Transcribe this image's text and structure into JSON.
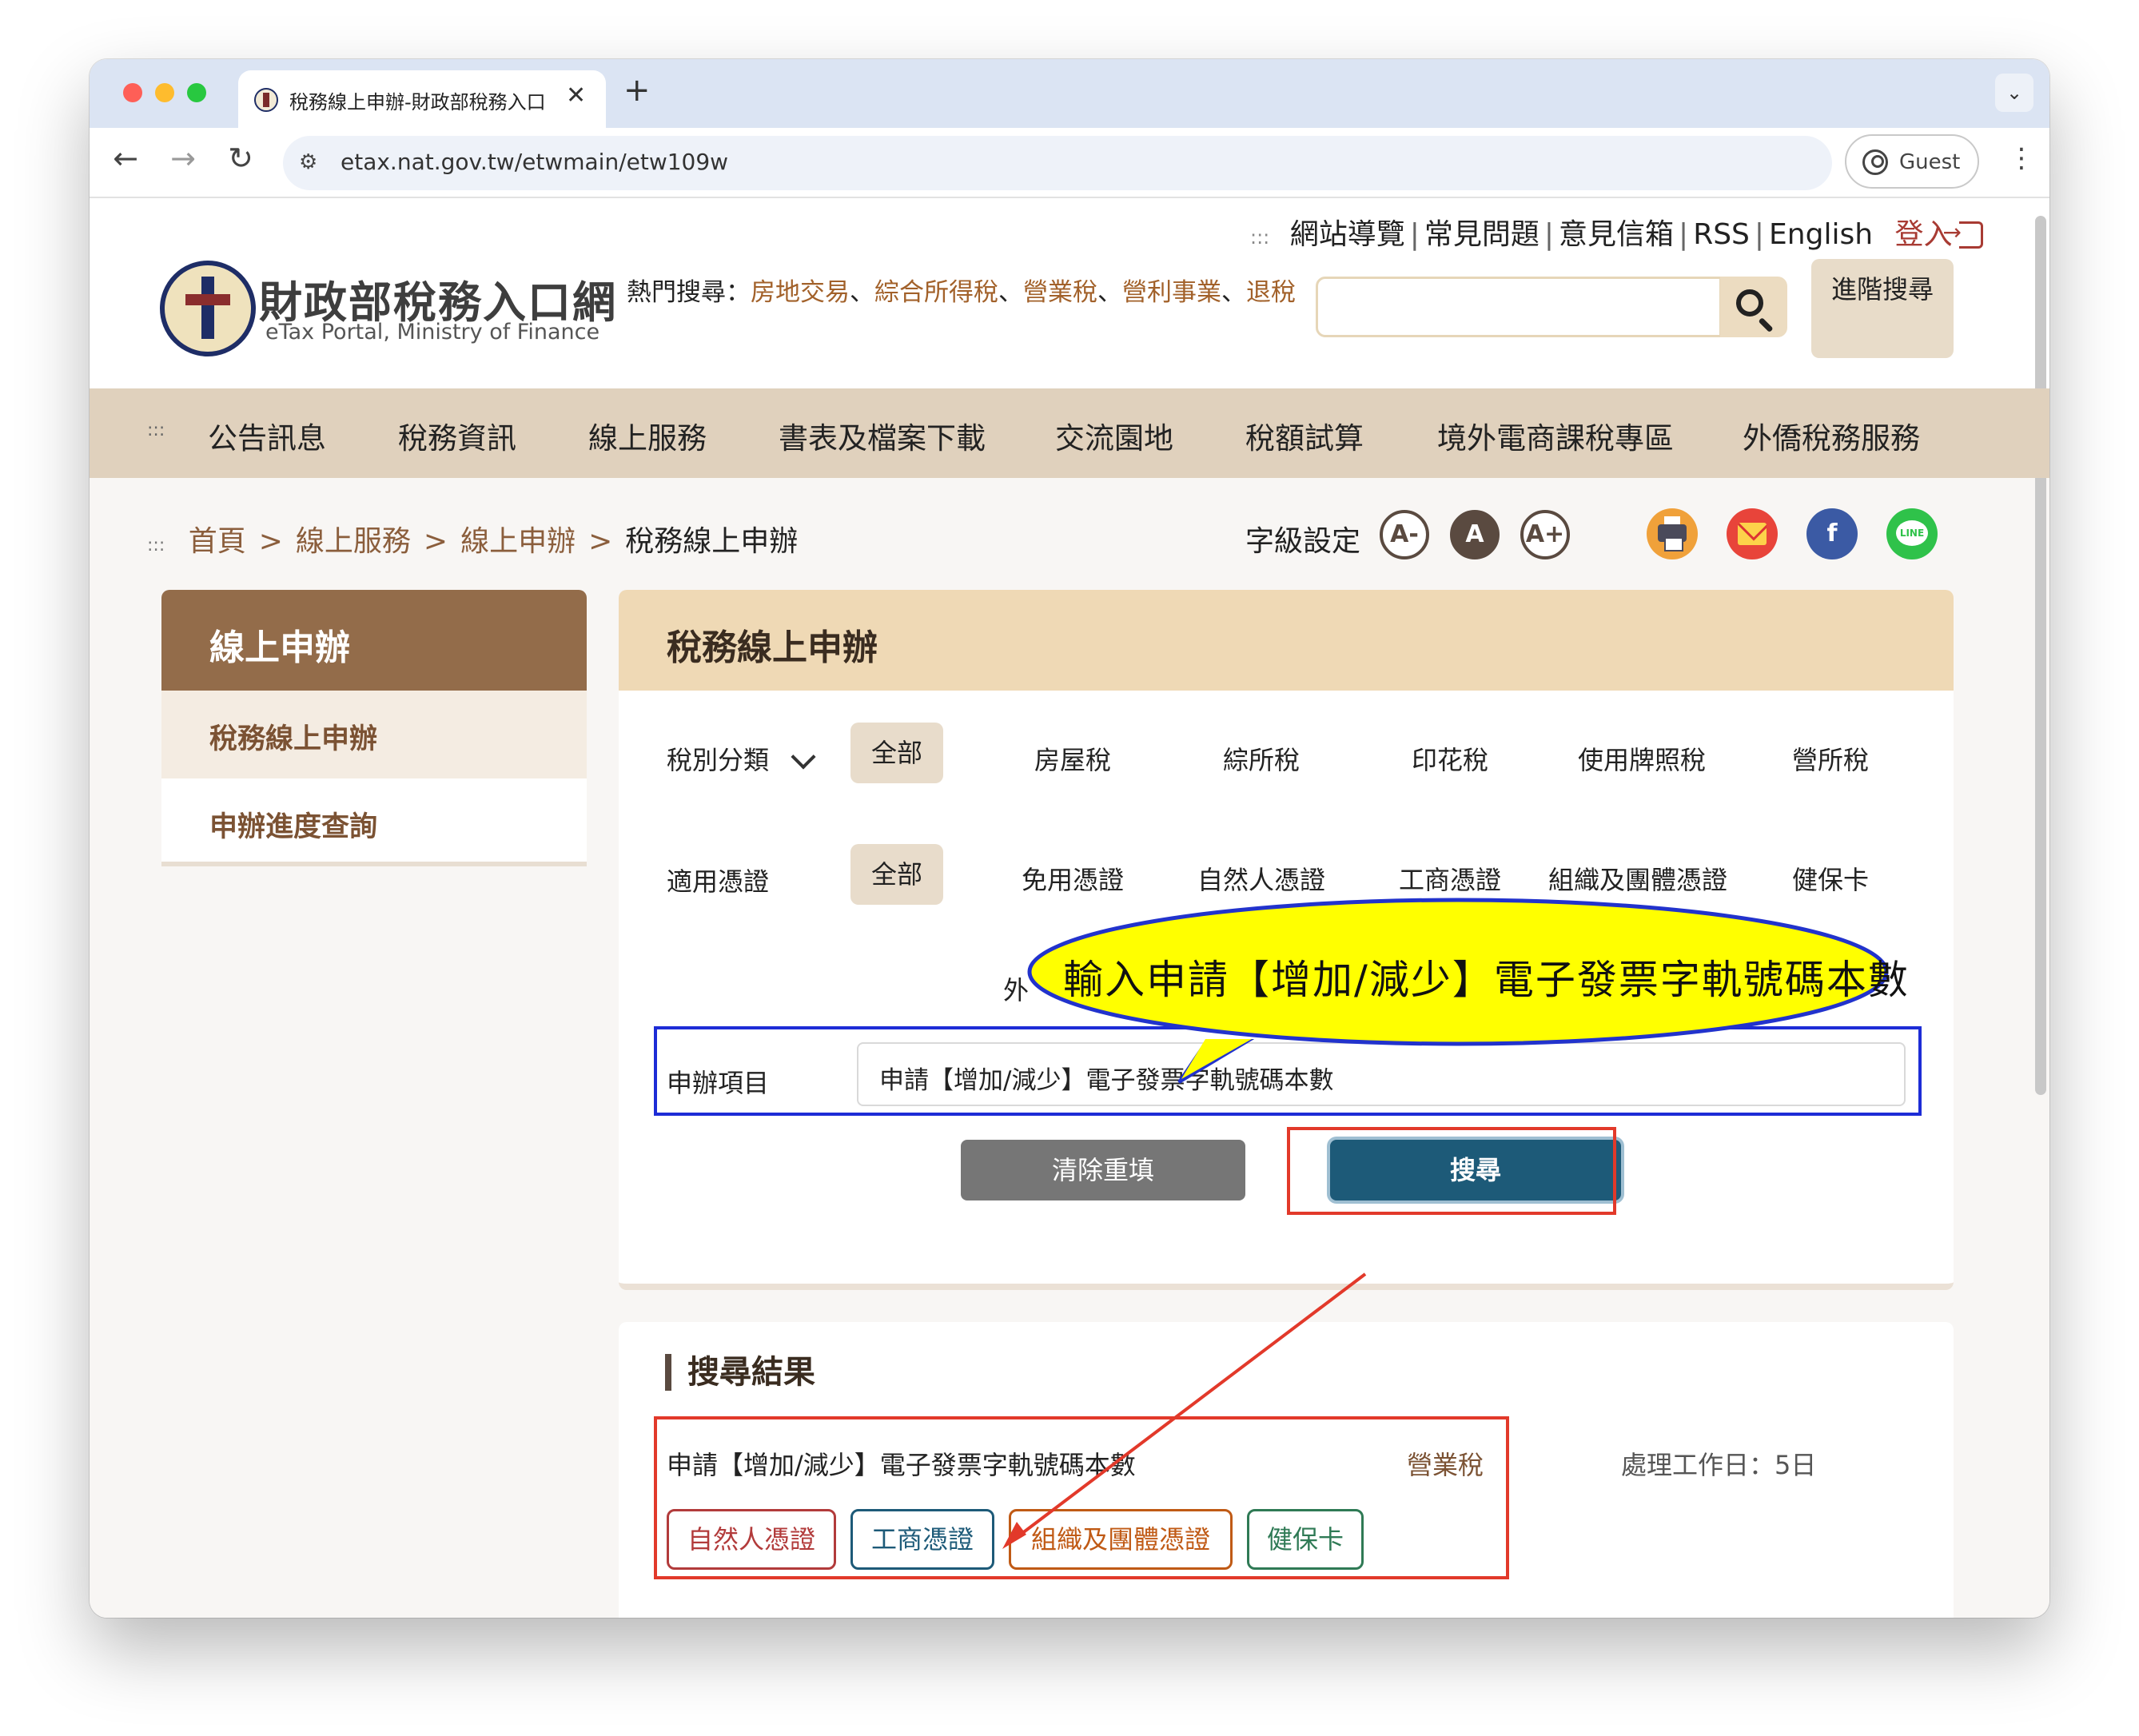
{
  "browser": {
    "tab_title": "稅務線上申辦-財政部稅務入口網",
    "tab_close": "✕",
    "new_tab": "+",
    "tab_menu": "⌄",
    "url": "etax.nat.gov.tw/etwmain/etw109w",
    "profile_label": "Guest",
    "nav_back": "←",
    "nav_forward": "→",
    "nav_reload": "↻",
    "kebab": "⋮",
    "site_info_icon": "⚙"
  },
  "header": {
    "top_links": [
      "網站導覽",
      "常見問題",
      "意見信箱",
      "RSS",
      "English"
    ],
    "login_label": "登入",
    "logo_title": "財政部稅務入口網",
    "logo_subtitle": "eTax Portal, Ministry of Finance",
    "hot_search_label": "熱門搜尋：",
    "hot_search_items": [
      "房地交易",
      "綜合所得稅",
      "營業稅",
      "營利事業",
      "退稅"
    ],
    "search_placeholder": "",
    "advanced_search_label": "進階搜尋"
  },
  "main_nav": [
    "公告訊息",
    "稅務資訊",
    "線上服務",
    "書表及檔案下載",
    "交流園地",
    "稅額試算",
    "境外電商課稅專區",
    "外僑稅務服務"
  ],
  "breadcrumb": [
    "首頁",
    "線上服務",
    "線上申辦",
    "稅務線上申辦"
  ],
  "breadcrumb_sep": ">",
  "font_setting": {
    "label": "字級設定",
    "options": [
      "A-",
      "A",
      "A+"
    ],
    "active": "A"
  },
  "share_icons": [
    "print-icon",
    "mail-icon",
    "facebook-icon",
    "line-icon"
  ],
  "share_labels": {
    "facebook": "f",
    "line": "LINE"
  },
  "sidebar": {
    "title": "線上申辦",
    "items": [
      "稅務線上申辦",
      "申辦進度查詢"
    ],
    "active_index": 0
  },
  "main": {
    "title": "稅務線上申辦",
    "tax_category": {
      "label": "稅別分類",
      "options": [
        "全部",
        "房屋稅",
        "綜所稅",
        "印花稅",
        "使用牌照稅",
        "營所稅"
      ],
      "selected": "全部"
    },
    "certificate": {
      "label": "適用憑證",
      "options": [
        "全部",
        "免用憑證",
        "自然人憑證",
        "工商憑證",
        "組織及團體憑證",
        "健保卡"
      ],
      "selected": "全部",
      "extra_option_partial": "外"
    },
    "apply_item": {
      "label": "申辦項目",
      "value": "申請【增加/減少】電子發票字軌號碼本數"
    },
    "clear_button": "清除重填",
    "search_button": "搜尋"
  },
  "results": {
    "title": "搜尋結果",
    "items": [
      {
        "name": "申請【增加/減少】電子發票字軌號碼本數",
        "tax_type": "營業稅",
        "processing_days": "處理工作日：5日",
        "tags": [
          "自然人憑證",
          "工商憑證",
          "組織及團體憑證",
          "健保卡"
        ]
      }
    ]
  },
  "annotation": {
    "callout_text": "輸入申請【增加/減少】電子發票字軌號碼本數",
    "callout_fill": "#ffff00",
    "callout_stroke": "#2233cc",
    "highlight_red": "#e2392a",
    "highlight_blue": "#1d2cd6"
  },
  "colors": {
    "brand_brown": "#936c4a",
    "nav_bg": "#e0d1bd",
    "panel_header": "#efd9b5",
    "search_button": "#1d5a78",
    "link_brown": "#8b5e3c",
    "login_red": "#a83b33"
  }
}
